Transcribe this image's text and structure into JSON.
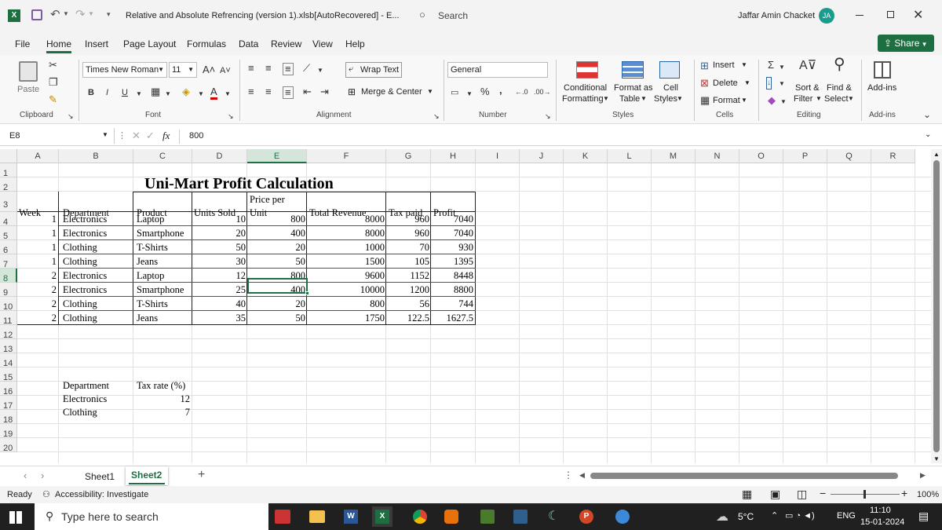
{
  "app": {
    "file_title": "Relative and Absolute Refrencing (version 1).xlsb[AutoRecovered]  -  E...",
    "search_placeholder": "Search",
    "user_name": "Jaffar Amin Chacket",
    "user_initials": "JA"
  },
  "menu": [
    "File",
    "Home",
    "Insert",
    "Page Layout",
    "Formulas",
    "Data",
    "Review",
    "View",
    "Help"
  ],
  "share_label": "Share",
  "ribbon": {
    "paste": "Paste",
    "clipboard": "Clipboard",
    "font_name": "Times New Roman",
    "font_size": "11",
    "font": "Font",
    "wrap_text": "Wrap Text",
    "merge_center": "Merge & Center",
    "alignment": "Alignment",
    "number_format": "General",
    "number": "Number",
    "conditional_1": "Conditional",
    "conditional_2": "Formatting",
    "format_as_1": "Format as",
    "format_as_2": "Table",
    "cell_styles_1": "Cell",
    "cell_styles_2": "Styles",
    "styles": "Styles",
    "insert": "Insert",
    "delete": "Delete",
    "format": "Format",
    "cells": "Cells",
    "sort_1": "Sort &",
    "sort_2": "Filter",
    "find_1": "Find &",
    "find_2": "Select",
    "editing": "Editing",
    "addins_btn": "Add-ins",
    "addins_grp": "Add-ins"
  },
  "formula": {
    "name_box": "E8",
    "fx": "fx",
    "value": "800"
  },
  "columns": [
    "A",
    "B",
    "C",
    "D",
    "E",
    "F",
    "G",
    "H",
    "I",
    "J",
    "K",
    "L",
    "M",
    "N",
    "O",
    "P",
    "Q",
    "R"
  ],
  "rows": [
    "1",
    "2",
    "3",
    "4",
    "5",
    "6",
    "7",
    "8",
    "9",
    "10",
    "11",
    "12",
    "13",
    "14",
    "15",
    "16",
    "17",
    "18",
    "19",
    "20"
  ],
  "sheet": {
    "title": "Uni-Mart Profit Calculation",
    "headers": {
      "week": "Week",
      "department": "Department",
      "product": "Product",
      "units_sold": "Units Sold",
      "price_1": "Price per",
      "price_2": "Unit",
      "revenue": "Total Revenue",
      "tax": "Tax paid",
      "profit": "Profit"
    },
    "data": [
      [
        "1",
        "Electronics",
        "Laptop",
        "10",
        "800",
        "8000",
        "960",
        "7040"
      ],
      [
        "1",
        "Electronics",
        "Smartphone",
        "20",
        "400",
        "8000",
        "960",
        "7040"
      ],
      [
        "1",
        "Clothing",
        "T-Shirts",
        "50",
        "20",
        "1000",
        "70",
        "930"
      ],
      [
        "1",
        "Clothing",
        "Jeans",
        "30",
        "50",
        "1500",
        "105",
        "1395"
      ],
      [
        "2",
        "Electronics",
        "Laptop",
        "12",
        "800",
        "9600",
        "1152",
        "8448"
      ],
      [
        "2",
        "Electronics",
        "Smartphone",
        "25",
        "400",
        "10000",
        "1200",
        "8800"
      ],
      [
        "2",
        "Clothing",
        "T-Shirts",
        "40",
        "20",
        "800",
        "56",
        "744"
      ],
      [
        "2",
        "Clothing",
        "Jeans",
        "35",
        "50",
        "1750",
        "122.5",
        "1627.5"
      ]
    ],
    "tax_table": {
      "h1": "Department",
      "h2": "Tax rate (%)",
      "rows": [
        [
          "Electronics",
          "12"
        ],
        [
          "Clothing",
          "7"
        ]
      ]
    }
  },
  "tabs": [
    "Sheet1",
    "Sheet2"
  ],
  "status": {
    "ready": "Ready",
    "accessibility": "Accessibility: Investigate",
    "zoom": "100%"
  },
  "taskbar": {
    "search": "Type here to search",
    "weather": "5°C",
    "lang": "ENG",
    "time": "11:10",
    "date": "15-01-2024"
  }
}
